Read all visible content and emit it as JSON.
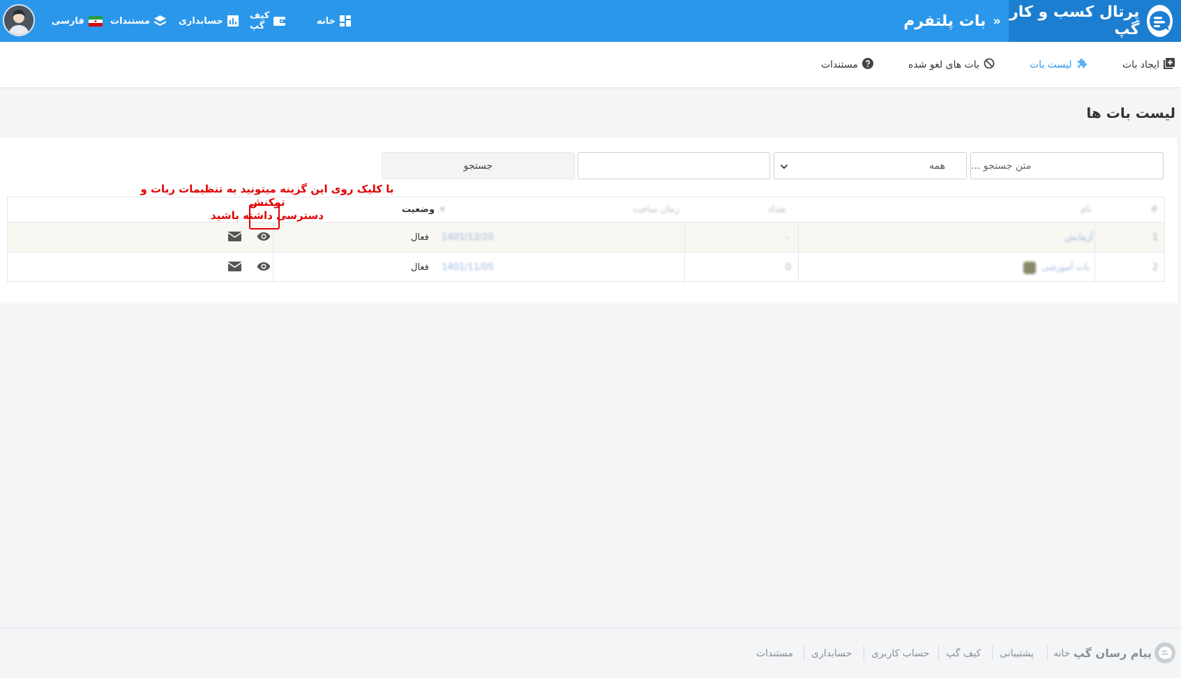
{
  "header": {
    "brand_title": "پرتال کسب و کار گپ",
    "breadcrumb_separator": "»",
    "page_context": "بات پلتفرم",
    "brand_color": "#1c7ed0",
    "bar_color": "#2b97ea"
  },
  "nav": {
    "home": "خانه",
    "wallet": "کیف گپ",
    "accounting": "حسابداری",
    "docs": "مستندات",
    "language": "فارسی"
  },
  "subnav": {
    "create_bot": "ایجاد بات",
    "bot_list": "لیست بات",
    "cancelled_bots": "بات های لغو شده",
    "docs": "مستندات",
    "active_color": "#2b97ea"
  },
  "page": {
    "title": "لیست بات ها"
  },
  "filters": {
    "search_placeholder": "متن جستجو ...",
    "select_value": "همه",
    "search_button": "جستجو"
  },
  "annotation": {
    "line1": "با کلیک روی این گزینه میتونید به تنظیمات ربات و توکنش",
    "line2": "دسترسی داشته باشید",
    "color": "#e00000"
  },
  "table": {
    "headers": {
      "index": "#",
      "name": "نام",
      "count": "تعداد",
      "date": "زمان ساخت",
      "status": "وضعیت"
    },
    "rows": [
      {
        "index": "1",
        "name": "آزمایش",
        "count": "-",
        "date": "1401/12/20",
        "status": "فعال"
      },
      {
        "index": "2",
        "name": "بات آموزشی",
        "count": "0",
        "date": "1401/11/05",
        "status": "فعال"
      }
    ]
  },
  "footer": {
    "brand": "پیام رسان گپ",
    "links": [
      "خانه",
      "پشتیبانی",
      "کیف گپ",
      "حساب کاربری",
      "حسابداری",
      "مستندات"
    ]
  }
}
